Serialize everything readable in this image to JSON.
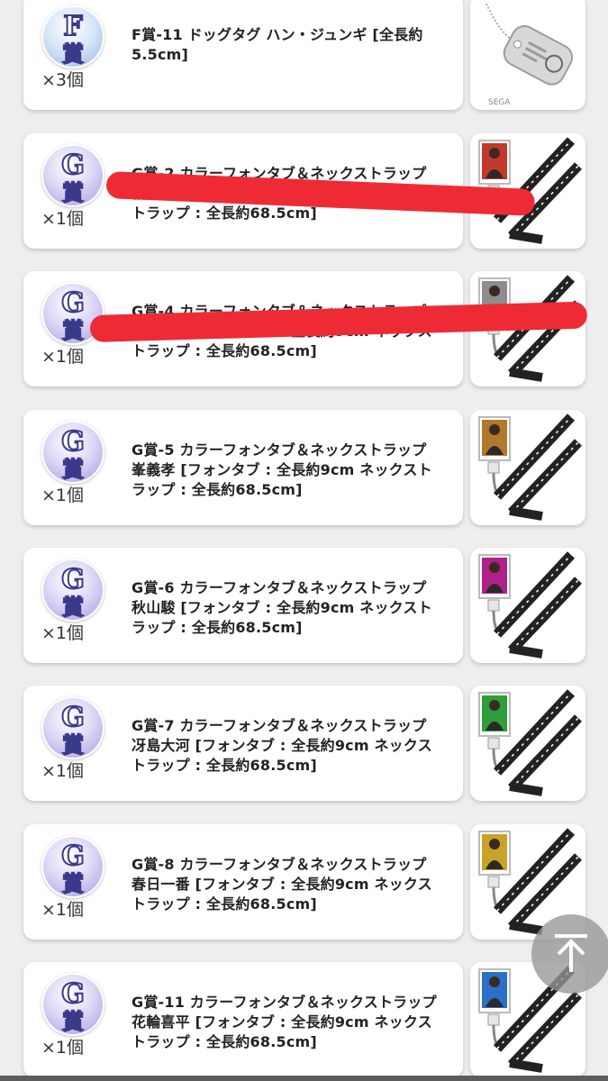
{
  "items": [
    {
      "grade": "F",
      "badge_char_top": "F",
      "badge_char_bottom": "賞",
      "title": "F賞-11 ドッグタグ ハン・ジュンギ [全長約5.5cm]",
      "qty": "×3個",
      "thumb": "dog-tag",
      "accent": "#9a9a9a"
    },
    {
      "grade": "G",
      "badge_char_top": "G",
      "badge_char_bottom": "賞",
      "title": "G賞-2 カラーフォンタブ＆ネックストラップ 桐生一馬 [フォンタブ : 全長約9cm ネックストラップ : 全長約68.5cm]",
      "qty": "×1個",
      "thumb": "lanyard",
      "accent": "#c0392b",
      "redacted": true
    },
    {
      "grade": "G",
      "badge_char_top": "G",
      "badge_char_bottom": "賞",
      "title": "G賞-4 カラーフォンタブ＆ネックストラップ 真島吾朗 [フォンタブ : 全長約9cm ネックストラップ : 全長約68.5cm]",
      "qty": "×1個",
      "thumb": "lanyard",
      "accent": "#8d8d8d",
      "redacted": true
    },
    {
      "grade": "G",
      "badge_char_top": "G",
      "badge_char_bottom": "賞",
      "title": "G賞-5 カラーフォンタブ＆ネックストラップ 峯義孝 [フォンタブ : 全長約9cm ネックストラップ : 全長約68.5cm]",
      "qty": "×1個",
      "thumb": "lanyard",
      "accent": "#b07a2a"
    },
    {
      "grade": "G",
      "badge_char_top": "G",
      "badge_char_bottom": "賞",
      "title": "G賞-6 カラーフォンタブ＆ネックストラップ 秋山駿 [フォンタブ : 全長約9cm ネックストラップ : 全長約68.5cm]",
      "qty": "×1個",
      "thumb": "lanyard",
      "accent": "#b0208a"
    },
    {
      "grade": "G",
      "badge_char_top": "G",
      "badge_char_bottom": "賞",
      "title": "G賞-7 カラーフォンタブ＆ネックストラップ 冴島大河 [フォンタブ : 全長約9cm ネックストラップ : 全長約68.5cm]",
      "qty": "×1個",
      "thumb": "lanyard",
      "accent": "#2e9e3a"
    },
    {
      "grade": "G",
      "badge_char_top": "G",
      "badge_char_bottom": "賞",
      "title": "G賞-8 カラーフォンタブ＆ネックストラップ 春日一番 [フォンタブ : 全長約9cm ネックストラップ : 全長約68.5cm]",
      "qty": "×1個",
      "thumb": "lanyard",
      "accent": "#c9a227"
    },
    {
      "grade": "G",
      "badge_char_top": "G",
      "badge_char_bottom": "賞",
      "title": "G賞-11 カラーフォンタブ＆ネックストラップ 花輪喜平 [フォンタブ : 全長約9cm ネックストラップ : 全長約68.5cm]",
      "qty": "×1個",
      "thumb": "lanyard",
      "accent": "#2a6fc9"
    }
  ],
  "scroll_top_icon": "arrow-up-to-top-icon"
}
